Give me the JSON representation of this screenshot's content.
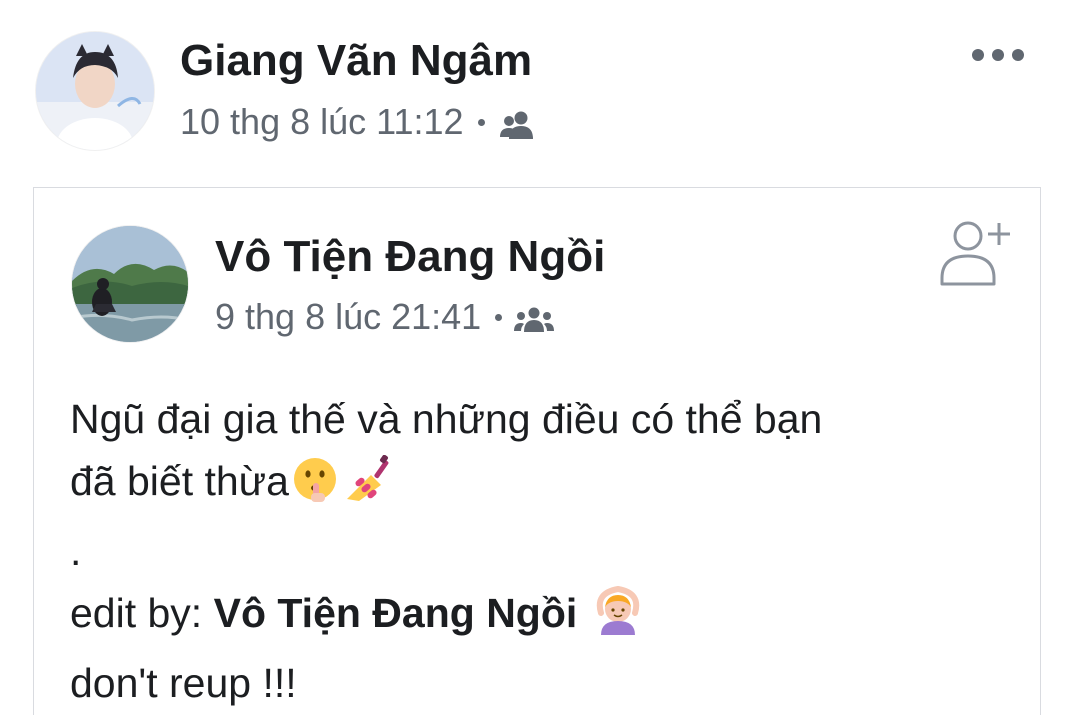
{
  "outer_post": {
    "author_name": "Giang Vãn Ngâm",
    "timestamp": "10 thg 8 lúc 11:12",
    "audience_icon": "friends-icon",
    "more_icon": "more-horizontal-icon"
  },
  "shared_post": {
    "author_name": "Vô Tiện Đang Ngồi",
    "timestamp": "9 thg 8 lúc 21:41",
    "audience_icon": "friends-icon",
    "add_friend_icon": "add-friend-icon",
    "body": {
      "line1": "Ngũ đại gia thế và những điều có thể bạn",
      "line2": "đã biết thừa",
      "line3": ".",
      "edit_prefix": "edit by: ",
      "edit_name": "Vô Tiện Đang Ngồi",
      "line5": "don't reup !!!"
    },
    "emojis": [
      "shushing-face-emoji",
      "nail-polish-emoji",
      "person-gesturing-ok-emoji"
    ]
  },
  "colors": {
    "text_primary": "#1c1e21",
    "text_secondary": "#606770",
    "border": "#d9dbe0"
  }
}
